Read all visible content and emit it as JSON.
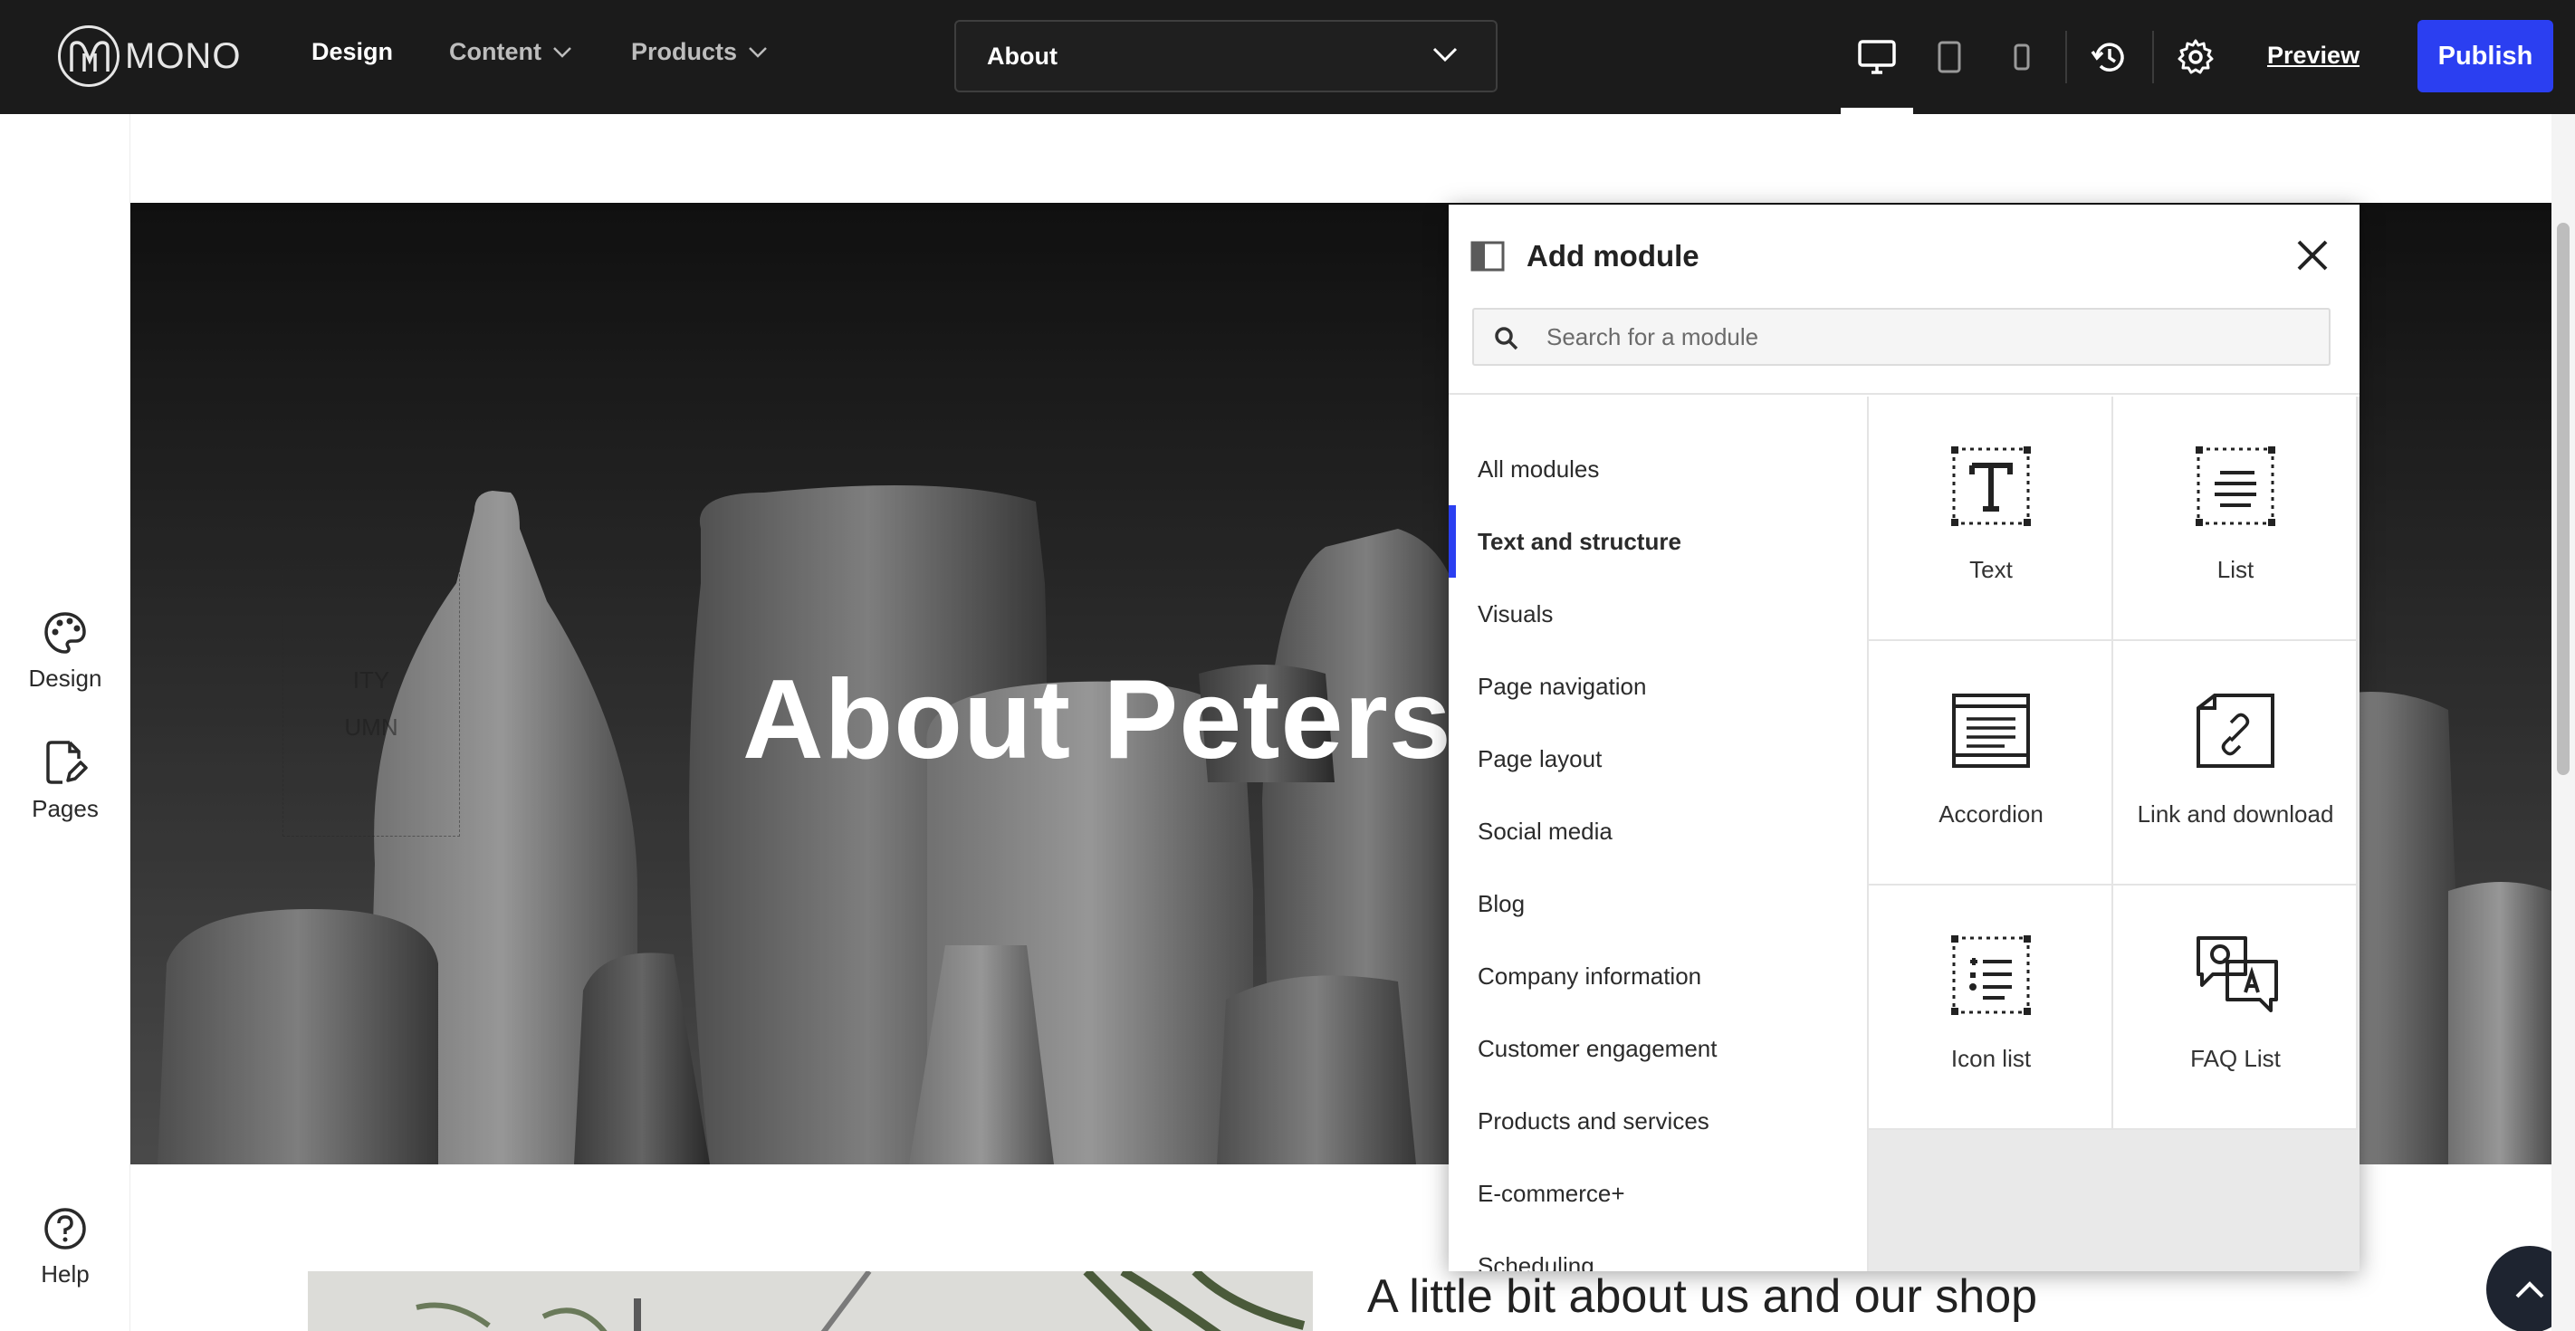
{
  "brand": {
    "name": "MONO"
  },
  "topnav": {
    "design": "Design",
    "content": "Content",
    "products": "Products",
    "page_select": "About",
    "preview": "Preview",
    "publish": "Publish"
  },
  "sidebar": {
    "design": "Design",
    "pages": "Pages",
    "help": "Help"
  },
  "hero": {
    "title": "About Peters",
    "empty_column_line1": "ITY",
    "empty_column_line2": "UMN"
  },
  "section": {
    "heading": "A little bit about us and our shop"
  },
  "panel": {
    "title": "Add module",
    "search_placeholder": "Search for a module",
    "categories": [
      "All modules",
      "Text and structure",
      "Visuals",
      "Page navigation",
      "Page layout",
      "Social media",
      "Blog",
      "Company information",
      "Customer engagement",
      "Products and services",
      "E-commerce+",
      "Scheduling"
    ],
    "active_category": "Text and structure",
    "modules": [
      "Text",
      "List",
      "Accordion",
      "Link and download",
      "Icon list",
      "FAQ List"
    ]
  },
  "colors": {
    "topbar": "#1b1b1b",
    "accent": "#2b3ff1"
  },
  "icons": [
    "desktop-icon",
    "tablet-icon",
    "mobile-icon",
    "history-icon",
    "gear-icon",
    "palette-icon",
    "page-edit-icon",
    "help-icon",
    "search-icon",
    "close-icon",
    "panel-toggle-icon",
    "chevron-up-icon"
  ]
}
